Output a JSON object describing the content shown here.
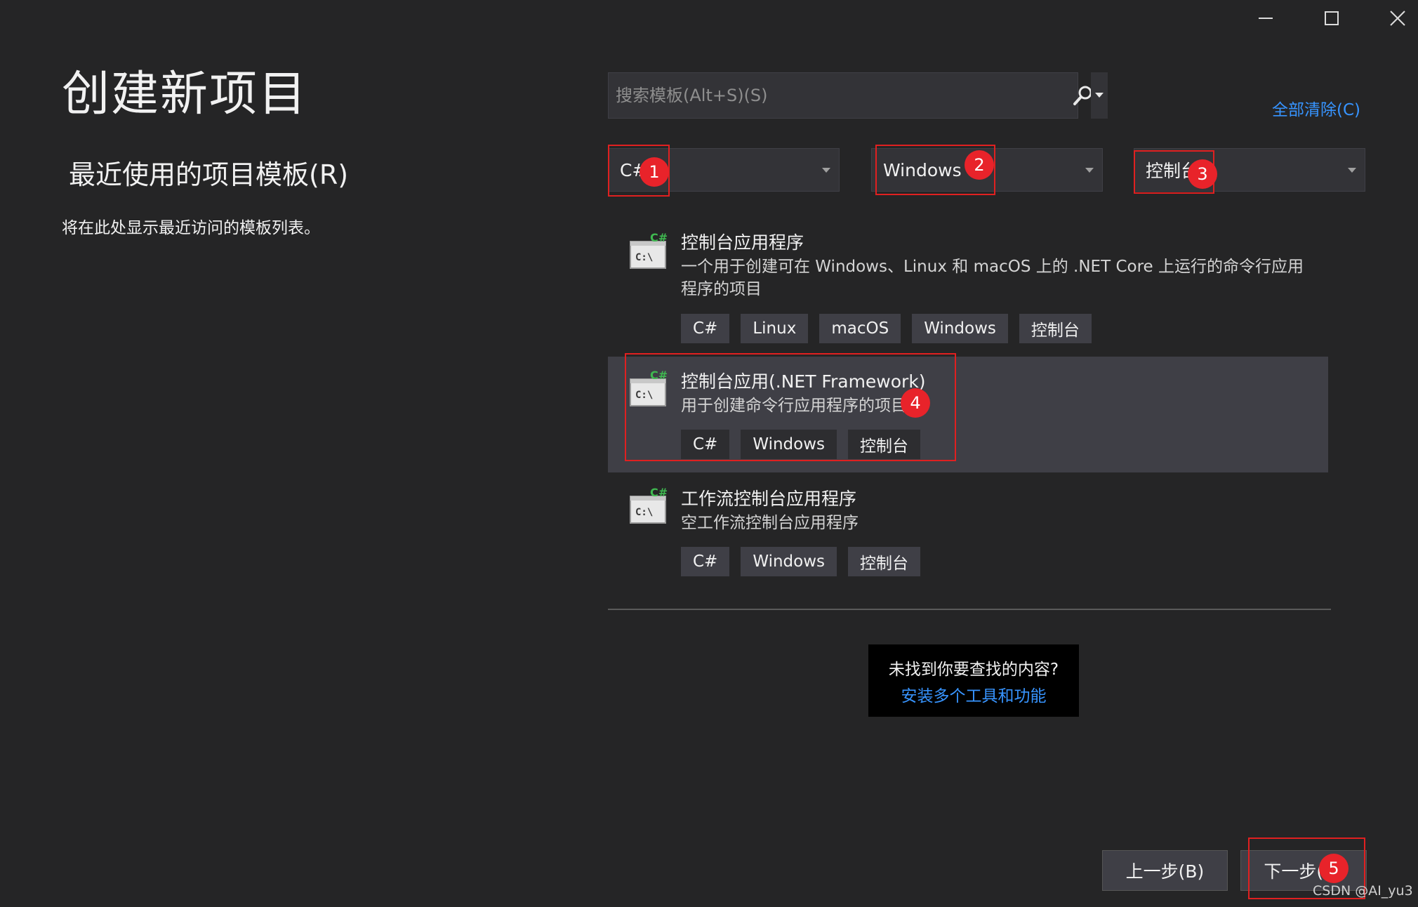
{
  "window": {
    "controls": [
      {
        "name": "minimize",
        "icon": "minimize-icon"
      },
      {
        "name": "maximize",
        "icon": "maximize-icon"
      },
      {
        "name": "close",
        "icon": "close-icon"
      }
    ]
  },
  "page": {
    "title": "创建新项目",
    "recent_header": "最近使用的项目模板(R)",
    "recent_empty_text": "将在此处显示最近访问的模板列表。"
  },
  "search": {
    "placeholder": "搜索模板(Alt+S)(S)",
    "value": "",
    "icon": "search-icon",
    "clear_all": "全部清除(C)"
  },
  "filters": {
    "language": "C#",
    "platform": "Windows",
    "project_type": "控制台"
  },
  "templates": [
    {
      "icon": "console-app-icon",
      "name": "控制台应用程序",
      "description": "一个用于创建可在 Windows、Linux 和 macOS 上的 .NET Core 上运行的命令行应用程序的项目",
      "tags": [
        "C#",
        "Linux",
        "macOS",
        "Windows",
        "控制台"
      ],
      "selected": false
    },
    {
      "icon": "console-app-icon",
      "name": "控制台应用(.NET Framework)",
      "description": "用于创建命令行应用程序的项目",
      "tags": [
        "C#",
        "Windows",
        "控制台"
      ],
      "selected": true
    },
    {
      "icon": "console-app-icon",
      "name": "工作流控制台应用程序",
      "description": "空工作流控制台应用程序",
      "tags": [
        "C#",
        "Windows",
        "控制台"
      ],
      "selected": false
    }
  ],
  "not_found": {
    "text": "未找到你要查找的内容?",
    "link": "安装多个工具和功能"
  },
  "buttons": {
    "back": "上一步(B)",
    "next": "下一步(N)"
  },
  "annotations": [
    "1",
    "2",
    "3",
    "4",
    "5"
  ],
  "watermark": "CSDN @AI_yu3",
  "colors": {
    "background": "#252526",
    "input": "#333337",
    "selected": "#3f3f46",
    "link": "#3794ff",
    "annotation": "#e8232a"
  }
}
